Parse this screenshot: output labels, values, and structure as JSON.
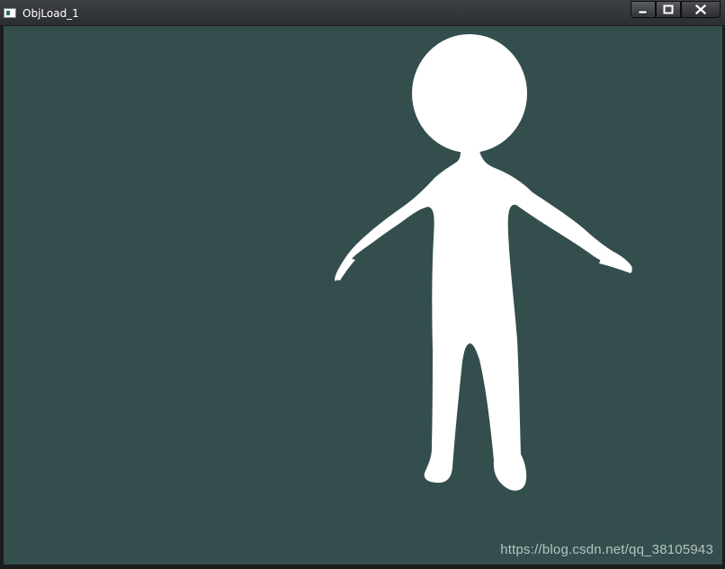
{
  "window": {
    "title": "ObjLoad_1",
    "controls": {
      "minimize_icon": "minimize-icon",
      "maximize_icon": "maximize-icon",
      "close_icon": "close-icon"
    }
  },
  "viewport": {
    "background_color": "#334e4d",
    "figure_color": "#ffffff"
  },
  "watermark": {
    "text": "https://blog.csdn.net/qq_38105943"
  }
}
